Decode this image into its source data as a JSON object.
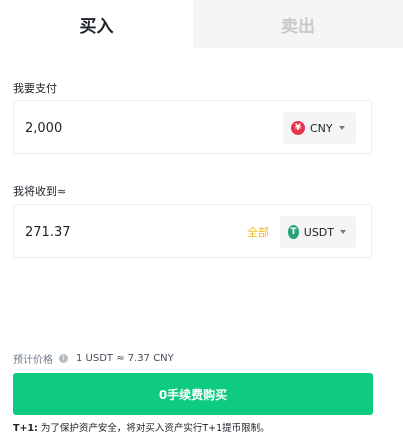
{
  "tabs": {
    "buy": "买入",
    "sell": "卖出"
  },
  "pay": {
    "label": "我要支付",
    "amount": "2,000",
    "currency": "CNY",
    "currency_icon_glyph": "¥",
    "currency_color": "#e8344e"
  },
  "receive": {
    "label": "我将收到≈",
    "amount": "271.37",
    "all_link": "全部",
    "currency": "USDT",
    "currency_icon_glyph": "T",
    "currency_color": "#26a17b"
  },
  "price": {
    "label": "预计价格",
    "value": "1 USDT ≈ 7.37 CNY"
  },
  "buy_button": "0手续费购买",
  "note": {
    "lead": "T+1:",
    "text": " 为了保护资产安全，将对买入资产实行T+1提币限制。"
  },
  "colors": {
    "accent_green": "#0ecb81",
    "link_yellow": "#f0b90b"
  }
}
